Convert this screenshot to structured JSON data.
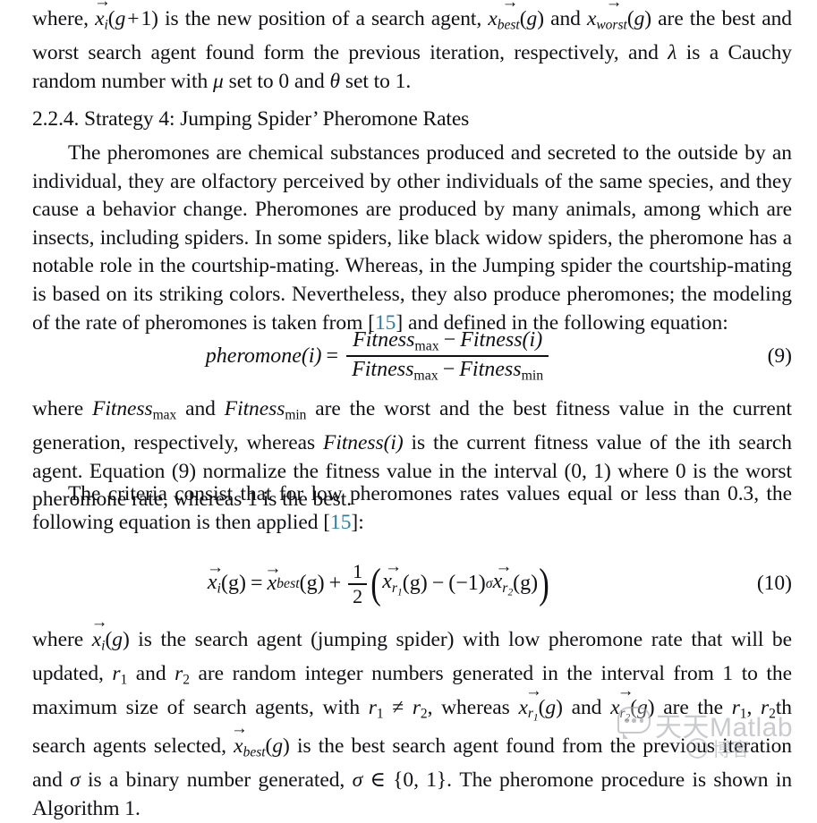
{
  "document": {
    "paragraph_1": {
      "lead": "where, ",
      "after_xi": " is the new position of a search agent, ",
      "and_1": " and ",
      "after_worst": " are the best and worst search agent found form the previous iteration, respectively, and ",
      "lambda": "λ",
      "after_lambda": " is a Cauchy random number with ",
      "mu": "μ",
      "after_mu": " set to 0 and ",
      "theta": "θ",
      "after_theta": " set to 1."
    },
    "heading": "2.2.4. Strategy 4: Jumping Spider’ Pheromone Rates",
    "paragraph_2": {
      "text_before_cite": "The pheromones are chemical substances produced and secreted to the outside by an individual, they are olfactory perceived by other individuals of the same species, and they cause a behavior change. Pheromones are produced by many animals, among which are insects, including spiders. In some spiders, like black widow spiders, the pheromone has a notable role in the courtship-mating. Whereas, in the Jumping spider the courtship-mating is based on its striking colors. Nevertheless, they also produce pheromones; the modeling of the rate of pheromones is taken from [",
      "citation": "15",
      "text_after_cite": "] and defined in the following equation:"
    },
    "equation_9": {
      "lhs": "pheromone(i)",
      "equals": "=",
      "numerator_fitness": "Fitness",
      "numerator_max": "max",
      "numerator_minus": "−",
      "numerator_fitness2": "Fitness(i)",
      "denominator_fitness": "Fitness",
      "denominator_max": "max",
      "denominator_minus": "−",
      "denominator_fitness2": "Fitness",
      "denominator_min": "min",
      "number": "(9)"
    },
    "paragraph_3": {
      "p1": "where ",
      "fitness": "Fitness",
      "max": "max",
      "p2": " and ",
      "min": "min",
      "p3": " are the worst and the best fitness value in the current generation, respectively, whereas ",
      "fitness_i": "Fitness(i)",
      "p4": " is the current fitness value of the ith search agent. Equation (9) normalize the fitness value in the interval (0, 1) where 0 is the worst pheromone rate, whereas 1 is the best."
    },
    "paragraph_4": {
      "text_before_cite": "The criteria consist that for low pheromones rates values equal or less than 0.3, the following equation is then applied [",
      "citation": "15",
      "text_after_cite": "]:"
    },
    "equation_10": {
      "x": "x",
      "sub_i": "i",
      "arg_g": "(g)",
      "equals": "=",
      "sub_best": "best",
      "plus": "+",
      "frac_num": "1",
      "frac_den": "2",
      "sub_r1": "r",
      "sub_r1_num": "1",
      "minus": "−",
      "neg_one": "(−1)",
      "sigma": "σ",
      "sub_r2": "r",
      "sub_r2_num": "2",
      "number": "(10)"
    },
    "paragraph_5": {
      "p1": "where ",
      "p2": " is the search agent (jumping spider) with low pheromone rate that will be updated, ",
      "r": "r",
      "one": "1",
      "p3": " and ",
      "two": "2",
      "p4": " are random integer numbers generated in the interval from 1 to the maximum size of search agents, with ",
      "neq": " ≠ ",
      "p5": ", whereas ",
      "p6": " and ",
      "p7": " are the ",
      "p8": "th search agents selected, ",
      "best": "best",
      "p9": " is the best search agent found from the previous iteration and ",
      "sigma": "σ",
      "p10": " is a binary number generated, ",
      "p11": " ∈ {0, 1}. The pheromone procedure is shown in Algorithm 1."
    }
  },
  "watermark": {
    "main_text": "天天Matlab",
    "sub_text": "博客",
    "copyright_symbol": "©",
    "color": "#96989e"
  }
}
